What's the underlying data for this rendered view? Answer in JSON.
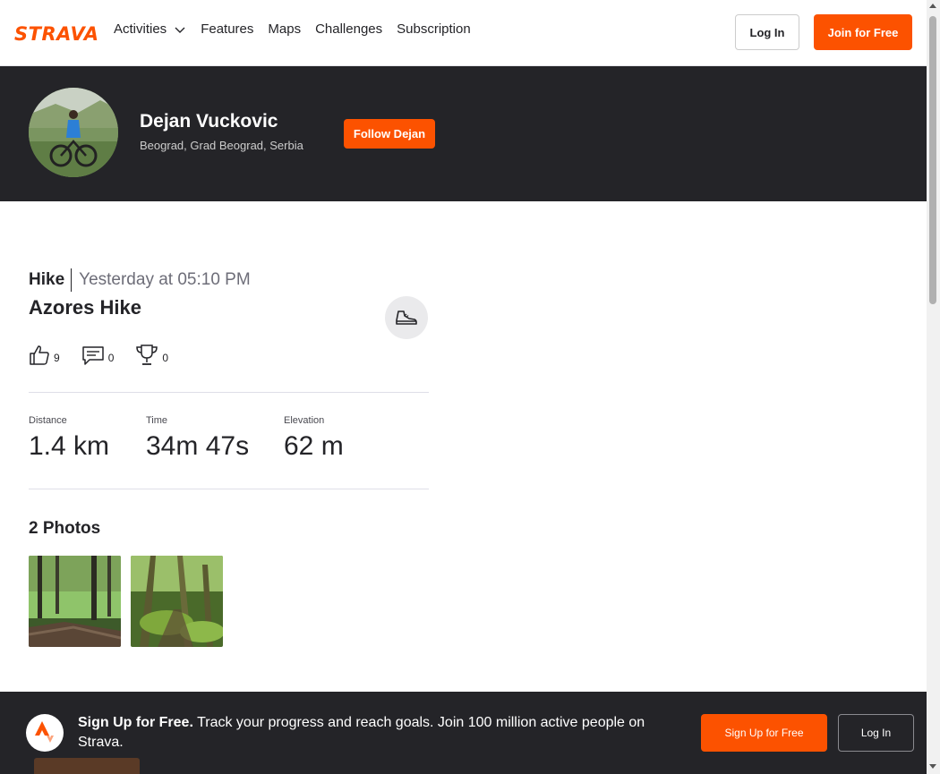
{
  "nav": {
    "logo": "STRAVA",
    "links": [
      "Activities",
      "Features",
      "Maps",
      "Challenges",
      "Subscription"
    ],
    "login_label": "Log In",
    "join_label": "Join for Free"
  },
  "athlete": {
    "name": "Dejan Vuckovic",
    "location": "Beograd, Grad Beograd, Serbia",
    "follow_label": "Follow Dejan"
  },
  "activity": {
    "type": "Hike",
    "date": "Yesterday at 05:10 PM",
    "title": "Azores Hike",
    "kudos": "9",
    "comments": "0",
    "achievements": "0",
    "stats": [
      {
        "label": "Distance",
        "value": "1.4 km"
      },
      {
        "label": "Time",
        "value": "34m 47s"
      },
      {
        "label": "Elevation",
        "value": "62 m"
      }
    ],
    "photos_title": "2 Photos"
  },
  "banner": {
    "bold": "Sign Up for Free.",
    "text": " Track your progress and reach goals. Join 100 million active people on Strava.",
    "signup_label": "Sign Up for Free",
    "login_label": "Log In"
  },
  "colors": {
    "brand": "#fc5200",
    "dark": "#242428"
  }
}
